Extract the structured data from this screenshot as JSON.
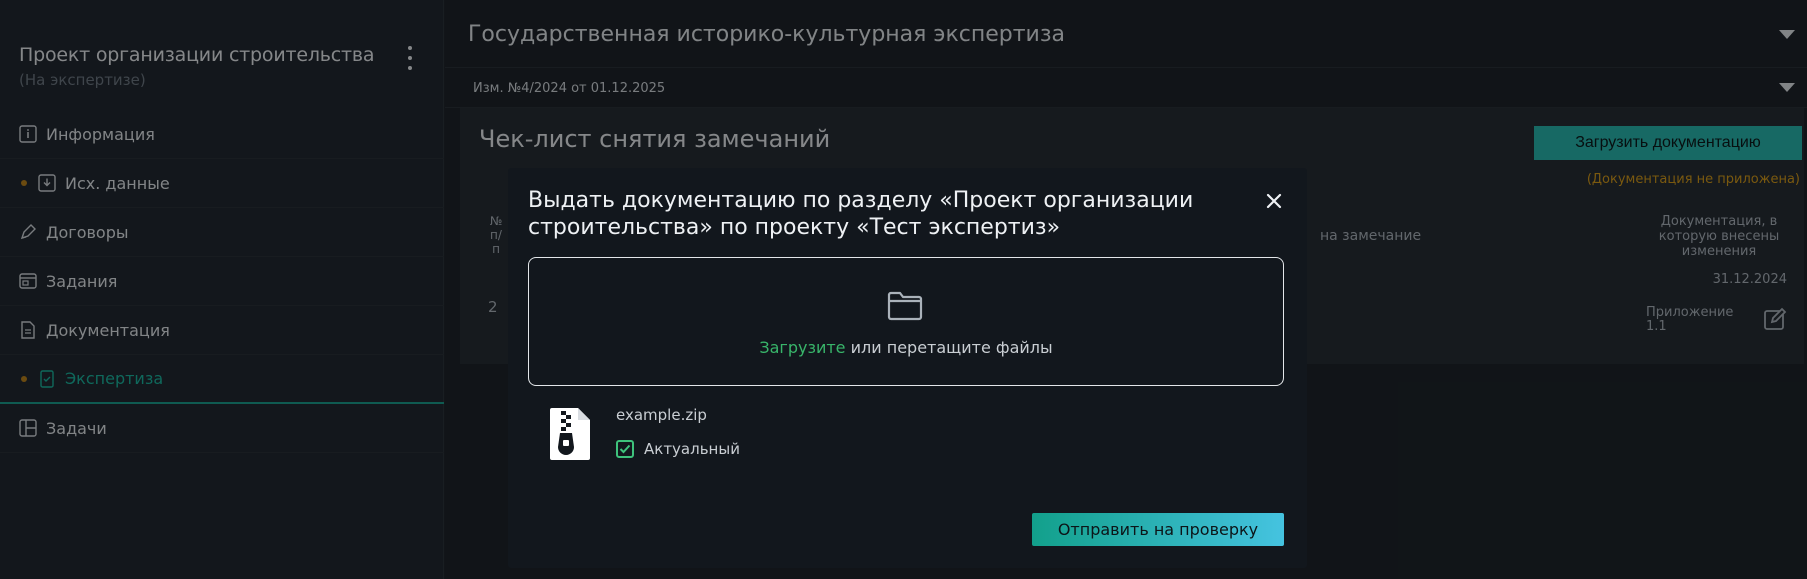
{
  "sidebar": {
    "project_title": "Проект организации строительства",
    "project_status": "(На экспертизе)",
    "items": [
      {
        "label": "Информация",
        "icon": "info-icon",
        "dot": false,
        "active": false
      },
      {
        "label": "Исх. данные",
        "icon": "download-box-icon",
        "dot": true,
        "active": false
      },
      {
        "label": "Договоры",
        "icon": "pen-icon",
        "dot": false,
        "active": false
      },
      {
        "label": "Задания",
        "icon": "window-icon",
        "dot": false,
        "active": false
      },
      {
        "label": "Документация",
        "icon": "document-icon",
        "dot": false,
        "active": false
      },
      {
        "label": "Экспертиза",
        "icon": "document-check-icon",
        "dot": true,
        "active": true
      },
      {
        "label": "Задачи",
        "icon": "board-icon",
        "dot": false,
        "active": false
      }
    ],
    "dot_color": "#b9821d",
    "active_color": "#1bb39e"
  },
  "main": {
    "section_title": "Государственная историко-культурная экспертиза",
    "revision_title": "Изм. №4/2024 от 01.12.2025",
    "panel": {
      "title": "Чек-лист снятия замечаний",
      "upload_button": "Загрузить документацию",
      "upload_note": "(Документация не приложена)",
      "columns": {
        "number": "№ п/ п",
        "remark": "на замечание",
        "docs": "Документация, в которую внесены изменения"
      },
      "row": {
        "date": "31.12.2024",
        "number": "2",
        "attachment": "Приложение 1.1"
      }
    }
  },
  "modal": {
    "title": "Выдать документацию по разделу «Проект организации строительства» по проекту «Тест экспертиз»",
    "dropzone": {
      "link_text": "Загрузите",
      "rest_text": "или перетащите файлы"
    },
    "file": {
      "name": "example.zip",
      "checkbox_label": "Актуальный",
      "checked": true
    },
    "submit_button": "Отправить на проверку",
    "accent_green": "#38b56a"
  }
}
